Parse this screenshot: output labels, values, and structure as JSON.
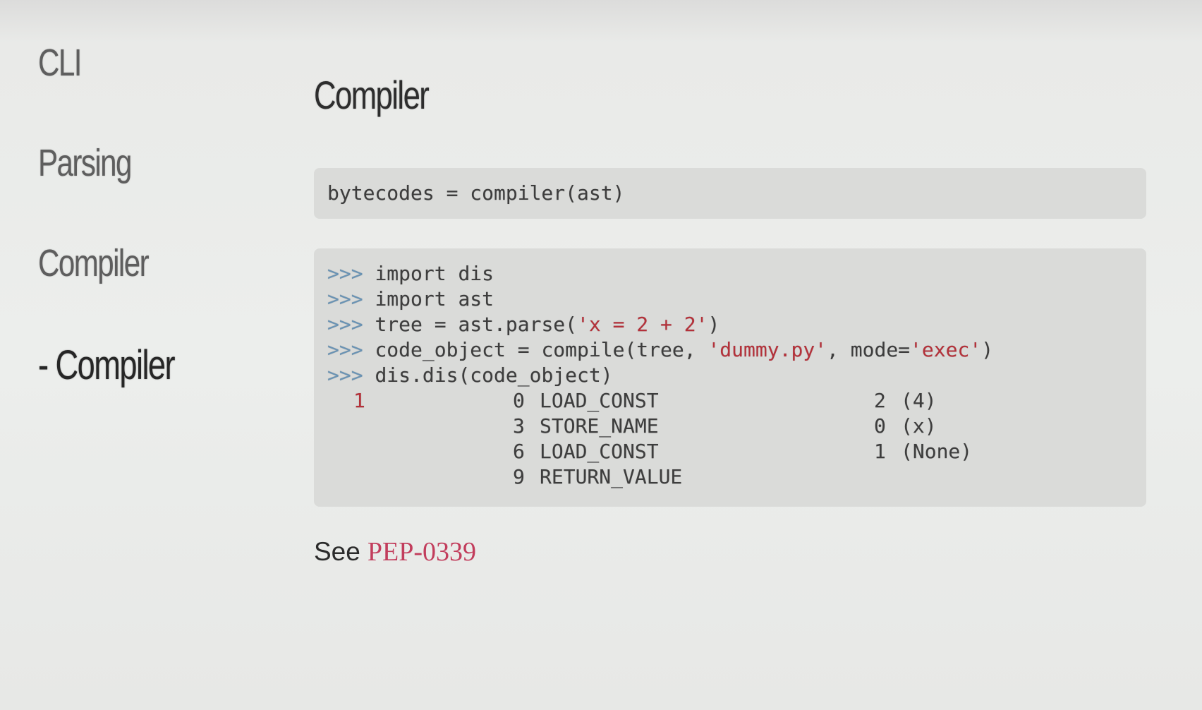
{
  "sidebar": {
    "items": [
      {
        "label": "CLI"
      },
      {
        "label": "Parsing"
      },
      {
        "label": "Compiler"
      },
      {
        "label": "- Compiler"
      }
    ]
  },
  "main": {
    "title": "Compiler",
    "code1": "bytecodes = compiler(ast)",
    "code2": {
      "prompt": ">>>",
      "lines": [
        {
          "prefix": "import dis",
          "str1": "",
          "mid": "",
          "str2": "",
          "suffix": ""
        },
        {
          "prefix": "import ast",
          "str1": "",
          "mid": "",
          "str2": "",
          "suffix": ""
        },
        {
          "prefix": "tree = ast.parse(",
          "str1": "'x = 2 + 2'",
          "mid": ")",
          "str2": "",
          "suffix": ""
        },
        {
          "prefix": "code_object = compile(tree, ",
          "str1": "'dummy.py'",
          "mid": ", mode=",
          "str2": "'exec'",
          "suffix": ")"
        },
        {
          "prefix": "dis.dis(code_object)",
          "str1": "",
          "mid": "",
          "str2": "",
          "suffix": ""
        }
      ],
      "dis_rows": [
        {
          "lineno": "1",
          "offset": "0",
          "opname": "LOAD_CONST",
          "arg": "2",
          "argrepr": "(4)"
        },
        {
          "lineno": "",
          "offset": "3",
          "opname": "STORE_NAME",
          "arg": "0",
          "argrepr": "(x)"
        },
        {
          "lineno": "",
          "offset": "6",
          "opname": "LOAD_CONST",
          "arg": "1",
          "argrepr": "(None)"
        },
        {
          "lineno": "",
          "offset": "9",
          "opname": "RETURN_VALUE",
          "arg": "",
          "argrepr": ""
        }
      ]
    },
    "see": {
      "prefix": "See",
      "link": "PEP-0339"
    }
  },
  "colors": {
    "background": "#eceeec",
    "code_bg": "#dadbd9",
    "prompt": "#6a93b4",
    "string": "#b4313a",
    "link": "#c23d5c"
  }
}
